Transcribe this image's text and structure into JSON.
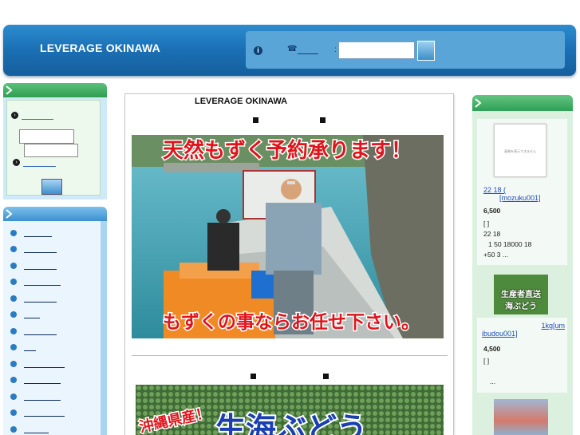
{
  "header": {
    "title": "LEVERAGE OKINAWA",
    "info_icon": "i",
    "tel_icon": "☎",
    "colon": ":"
  },
  "main": {
    "title": "LEVERAGE OKINAWA",
    "banner1_top": "天然もずく予約承ります！",
    "banner1_bottom": "もずくの事ならお任せ下さい。",
    "banner2_left": "沖縄県産！",
    "banner2_main": "生海ぶどう"
  },
  "right": {
    "products": [
      {
        "thumb_text": "画像を表示できません",
        "link_line1": "22 18 (",
        "link_line2": "[mozuku001]",
        "price": "6,500",
        "mark": "[ ]",
        "desc_line1": "22 18",
        "desc_line2": "1 50 18000 18",
        "desc_line3": "+50 3 ..."
      },
      {
        "thumb_line1": "生産者直送",
        "thumb_line2": "海ぶどう",
        "link_line1": "1kg[um",
        "link_line2": "ibudou001]",
        "price": "4,500",
        "mark": "[ ]",
        "desc_line1": "..."
      }
    ]
  },
  "colors": {
    "header_blue": "#1a6fb3",
    "green_accent": "#2fa055",
    "sidebar_blue": "#3c8fcf"
  }
}
